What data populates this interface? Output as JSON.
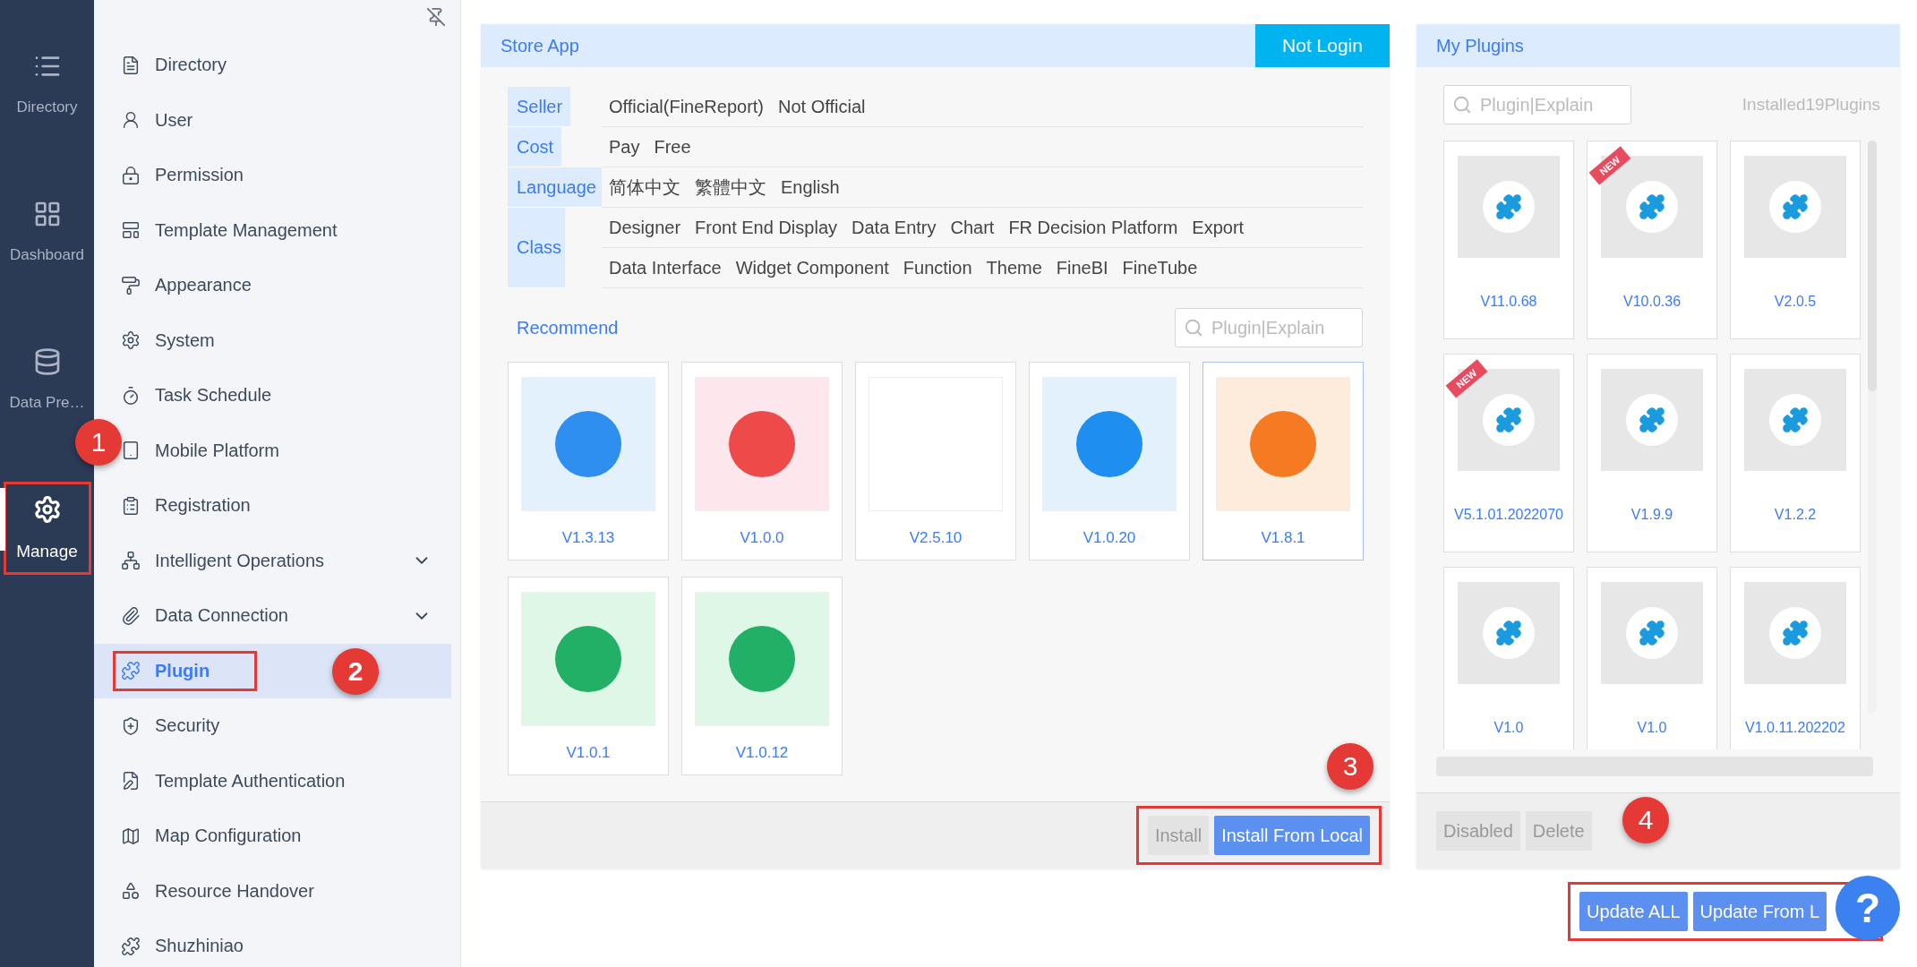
{
  "rail": [
    {
      "label": "Directory",
      "selected": false
    },
    {
      "label": "Dashboard",
      "selected": false
    },
    {
      "label": "Data Pre…",
      "selected": false
    },
    {
      "label": "Manage",
      "selected": true,
      "highlighted": true,
      "callout": "1"
    }
  ],
  "menu": [
    {
      "label": "Directory",
      "kind": "link",
      "selected": false
    },
    {
      "label": "User",
      "kind": "link",
      "selected": false
    },
    {
      "label": "Permission",
      "kind": "link",
      "selected": false
    },
    {
      "label": "Template Management",
      "kind": "link",
      "selected": false
    },
    {
      "label": "Appearance",
      "kind": "link",
      "selected": false
    },
    {
      "label": "System",
      "kind": "link",
      "selected": false
    },
    {
      "label": "Task Schedule",
      "kind": "link",
      "selected": false
    },
    {
      "label": "Mobile Platform",
      "kind": "link",
      "selected": false
    },
    {
      "label": "Registration",
      "kind": "link",
      "selected": false
    },
    {
      "label": "Intelligent Operations",
      "kind": "group",
      "expanded": false,
      "selected": false
    },
    {
      "label": "Data Connection",
      "kind": "group",
      "expanded": false,
      "selected": false
    },
    {
      "label": "Plugin",
      "kind": "link",
      "selected": true,
      "highlighted": true,
      "callout": "2"
    },
    {
      "label": "Security",
      "kind": "link",
      "selected": false
    },
    {
      "label": "Template Authentication",
      "kind": "link",
      "selected": false
    },
    {
      "label": "Map Configuration",
      "kind": "link",
      "selected": false
    },
    {
      "label": "Resource Handover",
      "kind": "link",
      "selected": false
    },
    {
      "label": "Shuzhiniao",
      "kind": "link",
      "selected": false
    }
  ],
  "store": {
    "title": "Store App",
    "login_button": "Not Login",
    "filters": [
      {
        "label": "Seller",
        "lines": [
          [
            "Official(FineReport)",
            "Not Official"
          ]
        ]
      },
      {
        "label": "Cost",
        "lines": [
          [
            "Pay",
            "Free"
          ]
        ]
      },
      {
        "label": "Language",
        "lines": [
          [
            "简体中文",
            "繁體中文",
            "English"
          ]
        ]
      },
      {
        "label": "Class",
        "lines": [
          [
            "Designer",
            "Front End Display",
            "Data Entry",
            "Chart",
            "FR Decision Platform",
            "Export"
          ],
          [
            "Data Interface",
            "Widget Component",
            "Function",
            "Theme",
            "FineBI",
            "FineTube"
          ]
        ]
      }
    ],
    "recommend_label": "Recommend",
    "search": {
      "placeholder": "Plugin|Explain"
    },
    "cards": [
      {
        "version": "V1.3.13",
        "color": "#e3f1fd",
        "kind": "logo",
        "selected": false
      },
      {
        "version": "V1.0.0",
        "color": "#fde6ec",
        "kind": "logo",
        "selected": false
      },
      {
        "version": "V2.5.10",
        "color": "#ffffff",
        "kind": "blank",
        "selected": false
      },
      {
        "version": "V1.0.20",
        "color": "#e3f1fd",
        "kind": "logo",
        "selected": false
      },
      {
        "version": "V1.8.1",
        "color": "#fdecdc",
        "kind": "logo",
        "selected": true
      },
      {
        "version": "V1.0.1",
        "color": "#dff7e6",
        "kind": "logo",
        "selected": false
      },
      {
        "version": "V1.0.12",
        "color": "#dff7e6",
        "kind": "logo",
        "selected": false
      }
    ],
    "footer": {
      "highlighted": true,
      "callout": "3",
      "buttons": [
        {
          "label": "Install",
          "disabled": true
        },
        {
          "label": "Install From Local",
          "disabled": false
        }
      ]
    }
  },
  "my_plugins": {
    "title": "My Plugins",
    "search": {
      "placeholder": "Plugin|Explain"
    },
    "installed_count": "Installed19Plugins",
    "plugins": [
      {
        "version": "V11.0.68"
      },
      {
        "version": "V10.0.36",
        "badge": "NEW"
      },
      {
        "version": "V2.0.5"
      },
      {
        "version": "V5.1.01.2022070",
        "badge": "NEW"
      },
      {
        "version": "V1.9.9"
      },
      {
        "version": "V1.2.2"
      },
      {
        "version": "V1.0"
      },
      {
        "version": "V1.0"
      },
      {
        "version": "V1.0.11.202202"
      }
    ],
    "footer": {
      "callout": "4",
      "buttons": [
        {
          "label": "Disabled",
          "disabled": true
        },
        {
          "label": "Delete",
          "disabled": true
        }
      ]
    },
    "update": {
      "highlighted": true,
      "buttons": [
        {
          "label": "Update ALL",
          "disabled": false
        },
        {
          "label": "Update From L",
          "disabled": false
        }
      ]
    }
  },
  "help_button": "?"
}
